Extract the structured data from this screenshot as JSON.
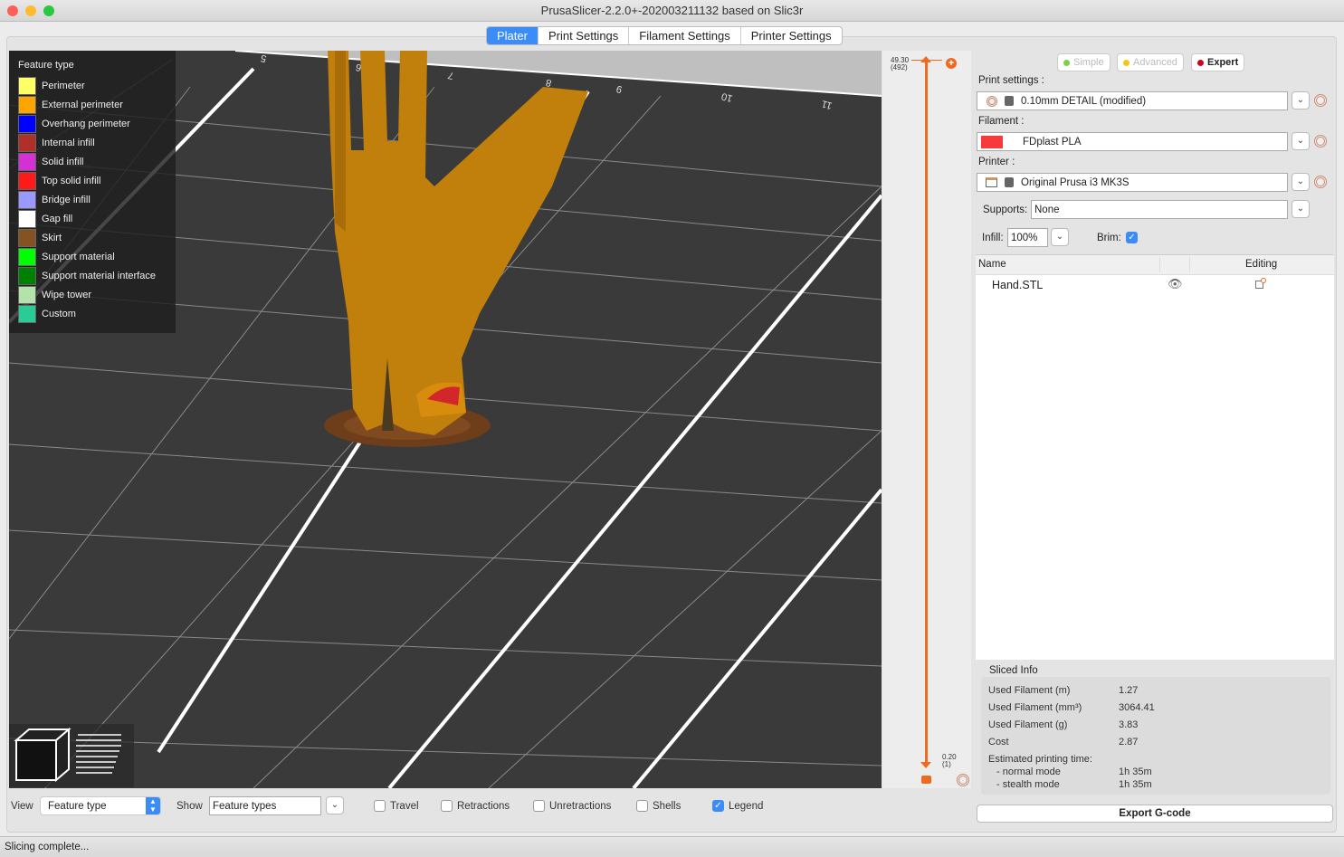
{
  "window": {
    "title": "PrusaSlicer-2.2.0+-202003211132 based on Slic3r"
  },
  "tabs": [
    {
      "label": "Plater",
      "active": true
    },
    {
      "label": "Print Settings"
    },
    {
      "label": "Filament Settings"
    },
    {
      "label": "Printer Settings"
    }
  ],
  "legend": {
    "title": "Feature type",
    "items": [
      {
        "label": "Perimeter",
        "color": "#ffff66"
      },
      {
        "label": "External perimeter",
        "color": "#ffa500"
      },
      {
        "label": "Overhang perimeter",
        "color": "#0000ff"
      },
      {
        "label": "Internal infill",
        "color": "#b03029"
      },
      {
        "label": "Solid infill",
        "color": "#d530d5"
      },
      {
        "label": "Top solid infill",
        "color": "#ff1a1a"
      },
      {
        "label": "Bridge infill",
        "color": "#9999ff"
      },
      {
        "label": "Gap fill",
        "color": "#ffffff"
      },
      {
        "label": "Skirt",
        "color": "#845321"
      },
      {
        "label": "Support material",
        "color": "#00ff00"
      },
      {
        "label": "Support material interface",
        "color": "#008000"
      },
      {
        "label": "Wipe tower",
        "color": "#b3e3ab"
      },
      {
        "label": "Custom",
        "color": "#28cc94"
      }
    ]
  },
  "bed": {
    "ruler_labels": [
      "5",
      "6",
      "7",
      "8",
      "9",
      "10",
      "11"
    ]
  },
  "layer_slider": {
    "top_height": "49.30",
    "top_layer": "(492)",
    "bottom_height": "0.20",
    "bottom_layer": "(1)",
    "accent": "#ed6b21"
  },
  "modes": [
    {
      "label": "Simple",
      "color": "#7cd04a"
    },
    {
      "label": "Advanced",
      "color": "#f5c518"
    },
    {
      "label": "Expert",
      "color": "#d0021b",
      "active": true
    }
  ],
  "print_settings": {
    "label": "Print settings :",
    "value": "0.10mm DETAIL (modified)"
  },
  "filament": {
    "label": "Filament :",
    "value": "FDplast PLA",
    "color": "#f73a3a"
  },
  "printer": {
    "label": "Printer :",
    "value": "Original Prusa i3 MK3S"
  },
  "supports": {
    "label": "Supports:",
    "value": "None"
  },
  "infill": {
    "label": "Infill:",
    "value": "100%"
  },
  "brim": {
    "label": "Brim:",
    "checked": true
  },
  "object_list": {
    "col_name": "Name",
    "col_editing": "Editing",
    "objects": [
      {
        "name": "Hand.STL"
      }
    ]
  },
  "sliced_info": {
    "title": "Sliced Info",
    "rows": [
      {
        "label": "Used Filament (m)",
        "value": "1.27"
      },
      {
        "label": "Used Filament (mm³)",
        "value": "3064.41"
      },
      {
        "label": "Used Filament (g)",
        "value": "3.83"
      },
      {
        "label": "Cost",
        "value": "2.87"
      }
    ],
    "time_label": "Estimated printing time:",
    "normal_label": "- normal mode",
    "normal_value": "1h 35m",
    "stealth_label": "- stealth mode",
    "stealth_value": "1h 35m"
  },
  "export_button": "Export G-code",
  "bottom_bar": {
    "view_label": "View",
    "view_value": "Feature type",
    "show_label": "Show",
    "show_value": "Feature types",
    "checks": [
      {
        "label": "Travel",
        "checked": false
      },
      {
        "label": "Retractions",
        "checked": false
      },
      {
        "label": "Unretractions",
        "checked": false
      },
      {
        "label": "Shells",
        "checked": false
      },
      {
        "label": "Legend",
        "checked": true
      }
    ]
  },
  "status": "Slicing complete..."
}
